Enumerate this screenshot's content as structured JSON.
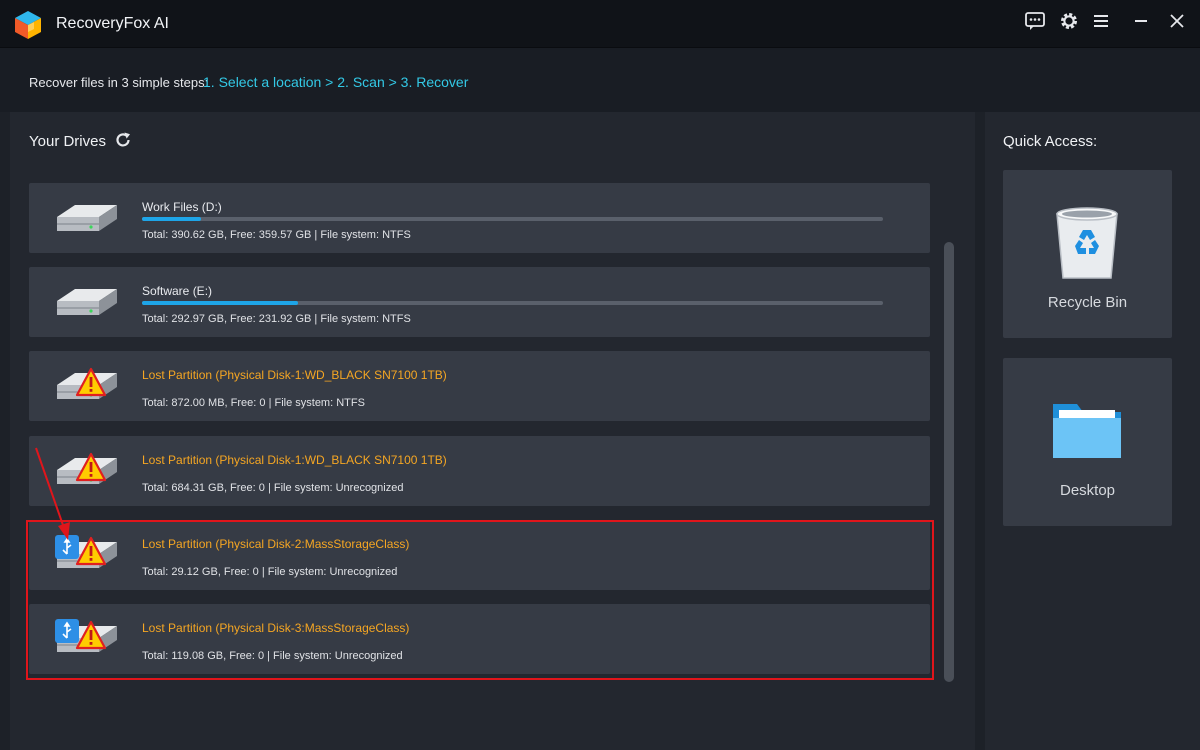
{
  "app": {
    "title": "RecoveryFox AI"
  },
  "steps": {
    "lead": "Recover files in 3 simple steps:",
    "path": "1. Select a location > 2. Scan > 3. Recover"
  },
  "drives": {
    "title": "Your Drives",
    "items": [
      {
        "name": "Work Files (D:)",
        "info": "Total: 390.62 GB, Free: 359.57 GB | File system: NTFS",
        "used_fraction": 0.08,
        "lost": false
      },
      {
        "name": "Software (E:)",
        "info": "Total: 292.97 GB, Free: 231.92 GB | File system: NTFS",
        "used_fraction": 0.21,
        "lost": false
      },
      {
        "name": "Lost Partition (Physical Disk-1:WD_BLACK SN7100 1TB)",
        "info": "Total: 872.00 MB, Free: 0 | File system: NTFS",
        "lost": true,
        "usb": false
      },
      {
        "name": "Lost Partition (Physical Disk-1:WD_BLACK SN7100 1TB)",
        "info": "Total: 684.31 GB, Free: 0 | File system: Unrecognized",
        "lost": true,
        "usb": false
      },
      {
        "name": "Lost Partition (Physical Disk-2:MassStorageClass)",
        "info": "Total: 29.12 GB, Free: 0 | File system: Unrecognized",
        "lost": true,
        "usb": true
      },
      {
        "name": "Lost Partition (Physical Disk-3:MassStorageClass)",
        "info": "Total: 119.08 GB, Free: 0 | File system: Unrecognized",
        "lost": true,
        "usb": true
      }
    ]
  },
  "quick_access": {
    "title": "Quick Access:",
    "tiles": [
      {
        "label": "Recycle Bin",
        "icon": "recycle-bin-icon"
      },
      {
        "label": "Desktop",
        "icon": "folder-icon"
      }
    ]
  },
  "colors": {
    "accent": "#33c9e6",
    "usage_fill": "#1ea5e8",
    "lost_text": "#f5a623",
    "highlight": "#e0151b"
  }
}
